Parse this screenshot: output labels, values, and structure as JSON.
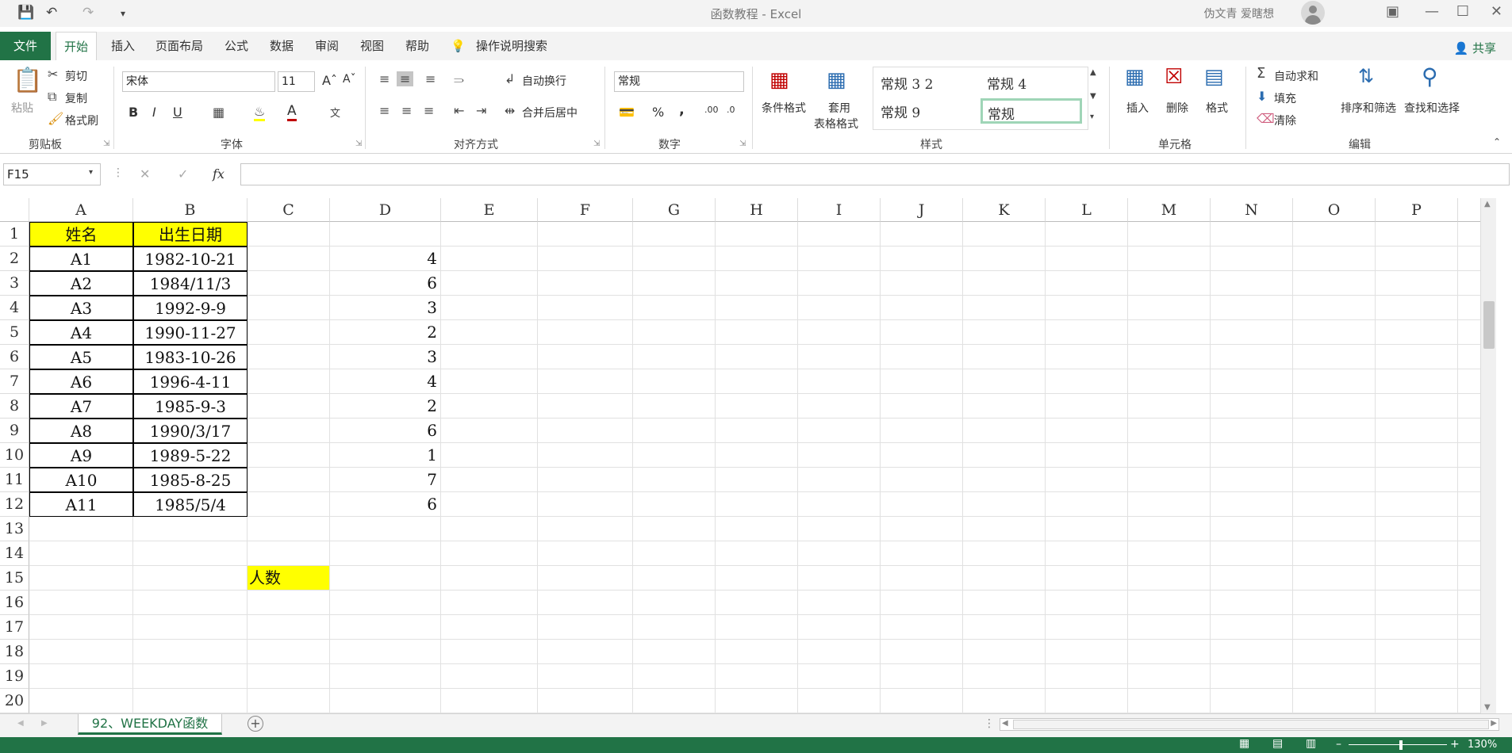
{
  "titlebar": {
    "doc_title": "函数教程  -  Excel",
    "user_name": "伪文青 爱瞎想",
    "qa_icons": [
      "save-icon",
      "undo-icon",
      "redo-icon",
      "customize-icon"
    ]
  },
  "tabs": {
    "file": "文件",
    "items": [
      "开始",
      "插入",
      "页面布局",
      "公式",
      "数据",
      "审阅",
      "视图",
      "帮助"
    ],
    "active": "开始",
    "tell_me": "操作说明搜索",
    "share": "共享"
  },
  "ribbon": {
    "clipboard": {
      "paste": "粘贴",
      "cut": "剪切",
      "copy": "复制",
      "format_painter": "格式刷",
      "label": "剪贴板"
    },
    "font": {
      "name": "宋体",
      "size": "11",
      "bold": "B",
      "italic": "I",
      "underline": "U",
      "label": "字体"
    },
    "alignment": {
      "wrap": "自动换行",
      "merge": "合并后居中",
      "label": "对齐方式"
    },
    "number": {
      "format": "常规",
      "percent": "%",
      "comma": ",",
      "label": "数字"
    },
    "styles": {
      "conditional": "条件格式",
      "table_format_1": "套用",
      "table_format_2": "表格格式",
      "items": [
        "常规 3 2",
        "常规 4",
        "常规 9",
        "常规"
      ],
      "label": "样式"
    },
    "cells": {
      "insert": "插入",
      "delete": "删除",
      "format": "格式",
      "label": "单元格"
    },
    "editing": {
      "autosum": "自动求和",
      "fill": "填充",
      "clear": "清除",
      "sort": "排序和筛选",
      "find": "查找和选择",
      "label": "编辑"
    }
  },
  "formula_bar": {
    "name_box": "F15",
    "fx": "fx",
    "value": ""
  },
  "grid": {
    "columns": [
      "A",
      "B",
      "C",
      "D",
      "E",
      "F",
      "G",
      "H",
      "I",
      "J",
      "K",
      "L",
      "M",
      "N",
      "O",
      "P"
    ],
    "rows": [
      "1",
      "2",
      "3",
      "4",
      "5",
      "6",
      "7",
      "8",
      "9",
      "10",
      "11",
      "12",
      "13",
      "14",
      "15",
      "16",
      "17",
      "18",
      "19",
      "20"
    ],
    "header": {
      "A": "姓名",
      "B": "出生日期"
    },
    "data": [
      {
        "name": "A1",
        "date": "1982-10-21",
        "d": "4"
      },
      {
        "name": "A2",
        "date": "1984/11/3",
        "d": "6"
      },
      {
        "name": "A3",
        "date": "1992-9-9",
        "d": "3"
      },
      {
        "name": "A4",
        "date": "1990-11-27",
        "d": "2"
      },
      {
        "name": "A5",
        "date": "1983-10-26",
        "d": "3"
      },
      {
        "name": "A6",
        "date": "1996-4-11",
        "d": "4"
      },
      {
        "name": "A7",
        "date": "1985-9-3",
        "d": "2"
      },
      {
        "name": "A8",
        "date": "1990/3/17",
        "d": "6"
      },
      {
        "name": "A9",
        "date": "1989-5-22",
        "d": "1"
      },
      {
        "name": "A10",
        "date": "1985-8-25",
        "d": "7"
      },
      {
        "name": "A11",
        "date": "1985/5/4",
        "d": "6"
      }
    ],
    "c15": "人数"
  },
  "sheet": {
    "tab": "92、WEEKDAY函数"
  },
  "status": {
    "zoom": "130%"
  },
  "colors": {
    "accent": "#217346",
    "highlight": "#ffff00"
  }
}
